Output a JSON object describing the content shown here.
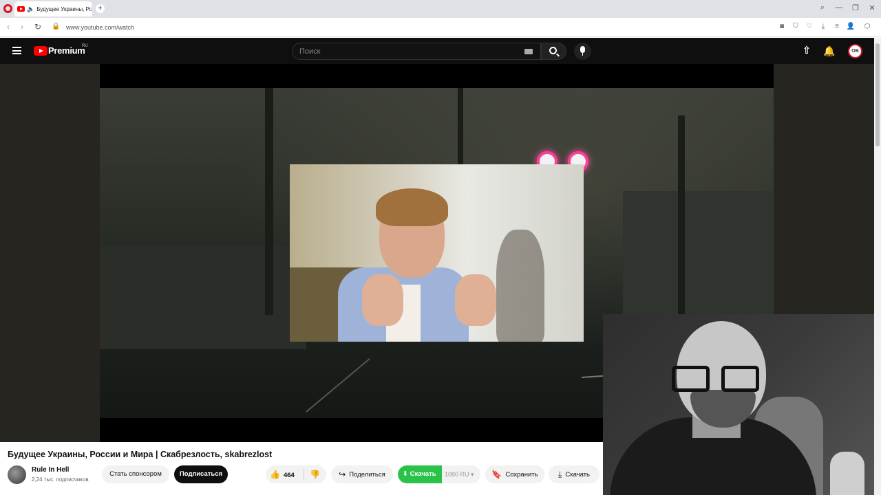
{
  "browser": {
    "tab_title": "Будущее Украины, Ро",
    "new_tab_glyph": "+",
    "url": "www.youtube.com/watch",
    "window_controls": [
      "⌕",
      "—",
      "❐",
      "✕"
    ],
    "nav_glyphs": [
      "‹",
      "›",
      "↻"
    ],
    "extension_icons": [
      "camera-icon",
      "shield-icon",
      "heart-icon",
      "download-icon",
      "menu-icon",
      "profile-icon",
      "box-icon"
    ]
  },
  "youtube": {
    "brand": "Premium",
    "region": "RU",
    "search_placeholder": "Поиск",
    "avatar_initials": "OB"
  },
  "video": {
    "title": "Будущее Украины, России и Мира | Скабрезлость, skabrezlost",
    "channel": "Rule In Hell",
    "subscribers": "2,24 тыс. подписчиков",
    "sponsor_label": "Стать спонсором",
    "subscribe_label": "Подписаться",
    "likes": "464",
    "share_label": "Поделиться",
    "download_label": "Скачать",
    "download_quality": "1080 RU",
    "save_label": "Сохранить",
    "download2_label": "Скачать"
  },
  "colors": {
    "youtube_red": "#ff0000",
    "download_green": "#2bc24a",
    "opera_red": "#e0111b"
  }
}
